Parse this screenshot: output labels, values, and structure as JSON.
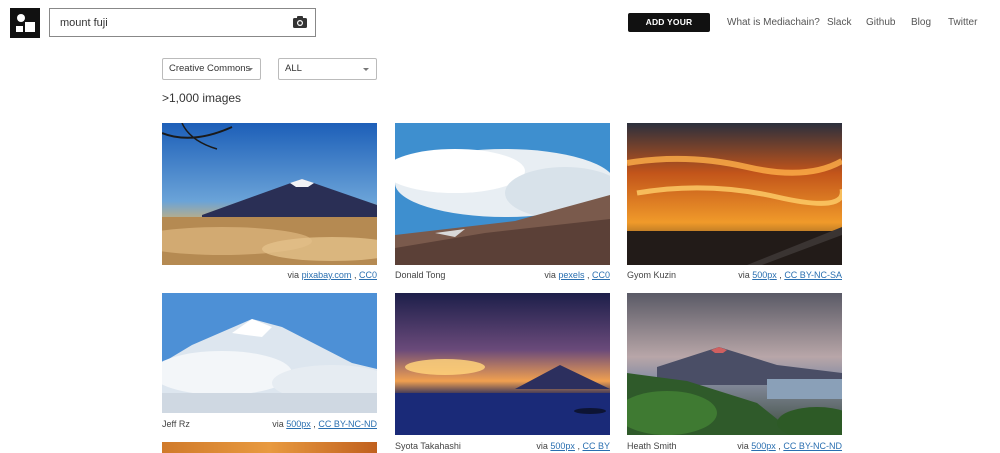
{
  "search": {
    "value": "mount fuji",
    "placeholder": ""
  },
  "header": {
    "add_button": "ADD YOUR IMAGES",
    "nav": [
      "What is Mediachain?",
      "Slack",
      "Github",
      "Blog",
      "Twitter"
    ]
  },
  "filters": {
    "license": "Creative Commons",
    "source": "ALL"
  },
  "results_count": ">1,000 images",
  "images": [
    {
      "author": "",
      "via": "via",
      "source": "pixabay.com",
      "sep": ",",
      "license": "CC0",
      "scene": "fuji-blue-sky-sunset"
    },
    {
      "author": "Donald Tong",
      "via": "via",
      "source": "pexels",
      "sep": ",",
      "license": "CC0",
      "scene": "cloudy-mountain-slope"
    },
    {
      "author": "Gyom Kuzin",
      "via": "via",
      "source": "500px",
      "sep": ",",
      "license": "CC BY-NC-SA",
      "scene": "orange-sunset-pier"
    },
    {
      "author": "Jeff Rz",
      "via": "via",
      "source": "500px",
      "sep": ",",
      "license": "CC BY-NC-ND",
      "scene": "snowy-peak-clouds"
    },
    {
      "author": "Syota Takahashi",
      "via": "via",
      "source": "500px",
      "sep": ",",
      "license": "CC BY",
      "scene": "sunrise-over-sea-fuji"
    },
    {
      "author": "Heath Smith",
      "via": "via",
      "source": "500px",
      "sep": ",",
      "license": "CC BY-NC-ND",
      "scene": "fuji-over-forest-lake"
    }
  ],
  "colors": {
    "accent": "#111111",
    "link": "#2a6fb0"
  }
}
